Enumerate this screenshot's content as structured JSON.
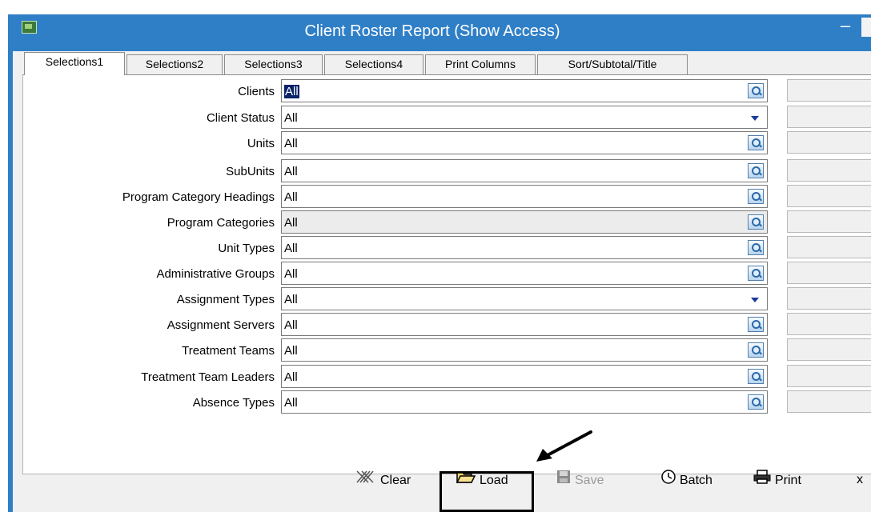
{
  "window": {
    "title": "Client Roster Report (Show Access)",
    "minimize_label": "–"
  },
  "tabs": [
    {
      "label": "Selections1",
      "active": true
    },
    {
      "label": "Selections2",
      "active": false
    },
    {
      "label": "Selections3",
      "active": false
    },
    {
      "label": "Selections4",
      "active": false
    },
    {
      "label": "Print Columns",
      "active": false
    },
    {
      "label": "Sort/Subtotal/Title",
      "active": false
    }
  ],
  "fields": [
    {
      "label": "Clients",
      "value": "All",
      "control": "lookup",
      "selected": true
    },
    {
      "label": "Client Status",
      "value": "All",
      "control": "dropdown"
    },
    {
      "label": "Units",
      "value": "All",
      "control": "lookup"
    },
    {
      "label": "SubUnits",
      "value": "All",
      "control": "lookup"
    },
    {
      "label": "Program Category Headings",
      "value": "All",
      "control": "lookup"
    },
    {
      "label": "Program Categories",
      "value": "All",
      "control": "lookup",
      "disabled": true
    },
    {
      "label": "Unit Types",
      "value": "All",
      "control": "lookup"
    },
    {
      "label": "Administrative Groups",
      "value": "All",
      "control": "lookup"
    },
    {
      "label": "Assignment Types",
      "value": "All",
      "control": "dropdown"
    },
    {
      "label": "Assignment Servers",
      "value": "All",
      "control": "lookup"
    },
    {
      "label": "Treatment Teams",
      "value": "All",
      "control": "lookup"
    },
    {
      "label": "Treatment Team Leaders",
      "value": "All",
      "control": "lookup"
    },
    {
      "label": "Absence Types",
      "value": "All",
      "control": "lookup"
    }
  ],
  "toolbar": {
    "clear_label": "Clear",
    "load_label": "Load",
    "save_label": "Save",
    "batch_label": "Batch",
    "print_label": "Print",
    "close_label": "x"
  },
  "icons": {
    "app": "app-icon",
    "lookup": "magnifier-icon",
    "dropdown": "chevron-down-icon",
    "clear": "eraser-icon",
    "load": "open-folder-icon",
    "save": "floppy-disk-icon",
    "batch": "clock-icon",
    "print": "printer-icon",
    "close": "close-icon"
  },
  "colors": {
    "titlebar": "#2f7fc7",
    "selection": "#0a246a",
    "dropdown_arrow": "#1a3a9b"
  }
}
